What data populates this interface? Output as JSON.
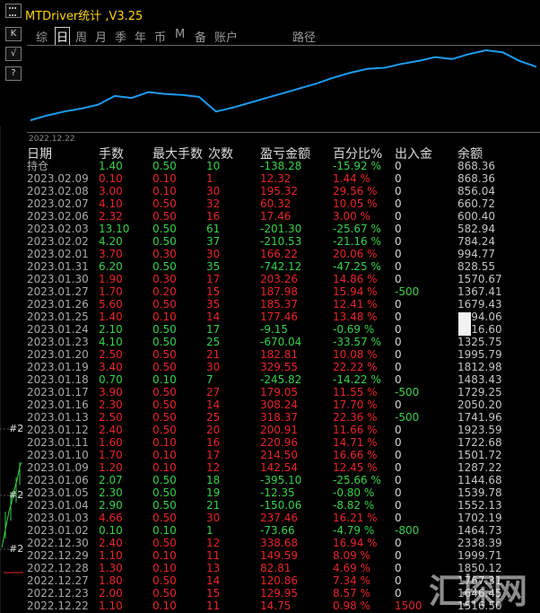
{
  "window": {
    "title": "MTDriver统计 ,V3.25"
  },
  "toolbar": {
    "buttons": [
      {
        "name": "grip-icon",
        "label": ""
      },
      {
        "name": "chart-style-button",
        "label": "K"
      },
      {
        "name": "check-button",
        "label": "√"
      },
      {
        "name": "help-button",
        "label": "?"
      }
    ]
  },
  "period_tabs": [
    {
      "label": "综",
      "active": false
    },
    {
      "label": "日",
      "active": true
    },
    {
      "label": "周",
      "active": false
    },
    {
      "label": "月",
      "active": false
    },
    {
      "label": "季",
      "active": false
    },
    {
      "label": "年",
      "active": false
    },
    {
      "label": "币",
      "active": false
    },
    {
      "label": "M",
      "active": false
    },
    {
      "label": "备",
      "active": false
    },
    {
      "label": "账户",
      "active": false
    },
    {
      "label": "路径",
      "active": false
    }
  ],
  "chart": {
    "start_label": "2022.12.22",
    "line_color": "#1e9bf0",
    "values": [
      5,
      10,
      14,
      17,
      21,
      30,
      28,
      34,
      32,
      31,
      29,
      14,
      18,
      23,
      28,
      33,
      38,
      43,
      49,
      54,
      58,
      59,
      63,
      66,
      70,
      68,
      73,
      77,
      75,
      66,
      60
    ]
  },
  "table": {
    "headers": [
      "日期",
      "手数",
      "最大手数",
      "次数",
      "盈亏金额",
      "百分比%",
      "出入金",
      "余额"
    ],
    "rows": [
      {
        "date": "持仓",
        "lots": "1.40",
        "max": "0.50",
        "count": "10",
        "pnl": "-138.28",
        "pct": "-15.92 %",
        "flow": "0",
        "balance": "868.36",
        "color": "green"
      },
      {
        "date": "2023.02.09",
        "lots": "0.10",
        "max": "0.10",
        "count": "1",
        "pnl": "12.32",
        "pct": "1.44 %",
        "flow": "0",
        "balance": "868.36",
        "color": "red"
      },
      {
        "date": "2023.02.08",
        "lots": "3.00",
        "max": "0.10",
        "count": "30",
        "pnl": "195.32",
        "pct": "29.56 %",
        "flow": "0",
        "balance": "856.04",
        "color": "red"
      },
      {
        "date": "2023.02.07",
        "lots": "4.10",
        "max": "0.50",
        "count": "32",
        "pnl": "60.32",
        "pct": "10.05 %",
        "flow": "0",
        "balance": "660.72",
        "color": "red"
      },
      {
        "date": "2023.02.06",
        "lots": "2.32",
        "max": "0.50",
        "count": "16",
        "pnl": "17.46",
        "pct": "3.00 %",
        "flow": "0",
        "balance": "600.40",
        "color": "red"
      },
      {
        "date": "2023.02.03",
        "lots": "13.10",
        "max": "0.50",
        "count": "61",
        "pnl": "-201.30",
        "pct": "-25.67 %",
        "flow": "0",
        "balance": "582.94",
        "color": "green"
      },
      {
        "date": "2023.02.02",
        "lots": "4.20",
        "max": "0.50",
        "count": "37",
        "pnl": "-210.53",
        "pct": "-21.16 %",
        "flow": "0",
        "balance": "784.24",
        "color": "green"
      },
      {
        "date": "2023.02.01",
        "lots": "3.70",
        "max": "0.30",
        "count": "30",
        "pnl": "166.22",
        "pct": "20.06 %",
        "flow": "0",
        "balance": "994.77",
        "color": "red"
      },
      {
        "date": "2023.01.31",
        "lots": "6.20",
        "max": "0.50",
        "count": "35",
        "pnl": "-742.12",
        "pct": "-47.25 %",
        "flow": "0",
        "balance": "828.55",
        "color": "green"
      },
      {
        "date": "2023.01.30",
        "lots": "1.90",
        "max": "0.30",
        "count": "17",
        "pnl": "203.26",
        "pct": "14.86 %",
        "flow": "0",
        "balance": "1570.67",
        "color": "red"
      },
      {
        "date": "2023.01.27",
        "lots": "1.70",
        "max": "0.20",
        "count": "15",
        "pnl": "187.98",
        "pct": "15.94 %",
        "flow": "-500",
        "balance": "1367.41",
        "color": "red"
      },
      {
        "date": "2023.01.26",
        "lots": "5.60",
        "max": "0.50",
        "count": "35",
        "pnl": "185.37",
        "pct": "12.41 %",
        "flow": "0",
        "balance": "1679.43",
        "color": "red"
      },
      {
        "date": "2023.01.25",
        "lots": "1.40",
        "max": "0.10",
        "count": "14",
        "pnl": "177.46",
        "pct": "13.48 %",
        "flow": "0",
        "balance": "1494.06",
        "color": "red"
      },
      {
        "date": "2023.01.24",
        "lots": "2.10",
        "max": "0.50",
        "count": "17",
        "pnl": "-9.15",
        "pct": "-0.69 %",
        "flow": "0",
        "balance": "1316.60",
        "color": "green"
      },
      {
        "date": "2023.01.23",
        "lots": "4.10",
        "max": "0.50",
        "count": "25",
        "pnl": "-670.04",
        "pct": "-33.57 %",
        "flow": "0",
        "balance": "1325.75",
        "color": "green"
      },
      {
        "date": "2023.01.20",
        "lots": "2.50",
        "max": "0.50",
        "count": "21",
        "pnl": "182.81",
        "pct": "10.08 %",
        "flow": "0",
        "balance": "1995.79",
        "color": "red"
      },
      {
        "date": "2023.01.19",
        "lots": "3.40",
        "max": "0.50",
        "count": "30",
        "pnl": "329.55",
        "pct": "22.22 %",
        "flow": "0",
        "balance": "1812.98",
        "color": "red"
      },
      {
        "date": "2023.01.18",
        "lots": "0.70",
        "max": "0.10",
        "count": "7",
        "pnl": "-245.82",
        "pct": "-14.22 %",
        "flow": "0",
        "balance": "1483.43",
        "color": "green"
      },
      {
        "date": "2023.01.17",
        "lots": "3.90",
        "max": "0.50",
        "count": "27",
        "pnl": "179.05",
        "pct": "11.55 %",
        "flow": "-500",
        "balance": "1729.25",
        "color": "red"
      },
      {
        "date": "2023.01.16",
        "lots": "2.30",
        "max": "0.50",
        "count": "14",
        "pnl": "308.24",
        "pct": "17.70 %",
        "flow": "0",
        "balance": "2050.20",
        "color": "red"
      },
      {
        "date": "2023.01.13",
        "lots": "2.50",
        "max": "0.50",
        "count": "25",
        "pnl": "318.37",
        "pct": "22.36 %",
        "flow": "-500",
        "balance": "1741.96",
        "color": "red"
      },
      {
        "date": "2023.01.12",
        "lots": "2.40",
        "max": "0.50",
        "count": "20",
        "pnl": "200.91",
        "pct": "11.66 %",
        "flow": "0",
        "balance": "1923.59",
        "color": "red"
      },
      {
        "date": "2023.01.11",
        "lots": "1.60",
        "max": "0.10",
        "count": "16",
        "pnl": "220.96",
        "pct": "14.71 %",
        "flow": "0",
        "balance": "1722.68",
        "color": "red"
      },
      {
        "date": "2023.01.10",
        "lots": "1.70",
        "max": "0.10",
        "count": "17",
        "pnl": "214.50",
        "pct": "16.66 %",
        "flow": "0",
        "balance": "1501.72",
        "color": "red"
      },
      {
        "date": "2023.01.09",
        "lots": "1.20",
        "max": "0.10",
        "count": "12",
        "pnl": "142.54",
        "pct": "12.45 %",
        "flow": "0",
        "balance": "1287.22",
        "color": "red"
      },
      {
        "date": "2023.01.06",
        "lots": "2.07",
        "max": "0.50",
        "count": "18",
        "pnl": "-395.10",
        "pct": "-25.66 %",
        "flow": "0",
        "balance": "1144.68",
        "color": "green"
      },
      {
        "date": "2023.01.05",
        "lots": "2.30",
        "max": "0.50",
        "count": "19",
        "pnl": "-12.35",
        "pct": "-0.80 %",
        "flow": "0",
        "balance": "1539.78",
        "color": "green"
      },
      {
        "date": "2023.01.04",
        "lots": "2.90",
        "max": "0.50",
        "count": "21",
        "pnl": "-150.06",
        "pct": "-8.82 %",
        "flow": "0",
        "balance": "1552.13",
        "color": "green"
      },
      {
        "date": "2023.01.03",
        "lots": "4.66",
        "max": "0.50",
        "count": "30",
        "pnl": "237.46",
        "pct": "16.21 %",
        "flow": "0",
        "balance": "1702.19",
        "color": "red"
      },
      {
        "date": "2023.01.02",
        "lots": "0.10",
        "max": "0.10",
        "count": "1",
        "pnl": "-73.66",
        "pct": "-4.79 %",
        "flow": "-800",
        "balance": "1464.73",
        "color": "green"
      },
      {
        "date": "2022.12.30",
        "lots": "2.40",
        "max": "0.50",
        "count": "12",
        "pnl": "338.68",
        "pct": "16.94 %",
        "flow": "0",
        "balance": "2338.39",
        "color": "red"
      },
      {
        "date": "2022.12.29",
        "lots": "1.10",
        "max": "0.10",
        "count": "11",
        "pnl": "149.59",
        "pct": "8.09 %",
        "flow": "0",
        "balance": "1999.71",
        "color": "red"
      },
      {
        "date": "2022.12.28",
        "lots": "1.30",
        "max": "0.10",
        "count": "13",
        "pnl": "82.81",
        "pct": "4.69 %",
        "flow": "0",
        "balance": "1850.12",
        "color": "red"
      },
      {
        "date": "2022.12.27",
        "lots": "1.80",
        "max": "0.50",
        "count": "14",
        "pnl": "120.86",
        "pct": "7.34 %",
        "flow": "0",
        "balance": "1767.31",
        "color": "red"
      },
      {
        "date": "2022.12.23",
        "lots": "2.00",
        "max": "0.50",
        "count": "15",
        "pnl": "129.95",
        "pct": "8.57 %",
        "flow": "0",
        "balance": "1646.45",
        "color": "red"
      },
      {
        "date": "2022.12.22",
        "lots": "1.10",
        "max": "0.10",
        "count": "11",
        "pnl": "14.75",
        "pct": "0.98 %",
        "flow": "1500",
        "balance": "1516.50",
        "color": "red"
      }
    ]
  },
  "left_chart": {
    "labels": [
      "#2",
      "#2",
      "#2"
    ]
  },
  "watermark": {
    "text": "汇探网"
  }
}
